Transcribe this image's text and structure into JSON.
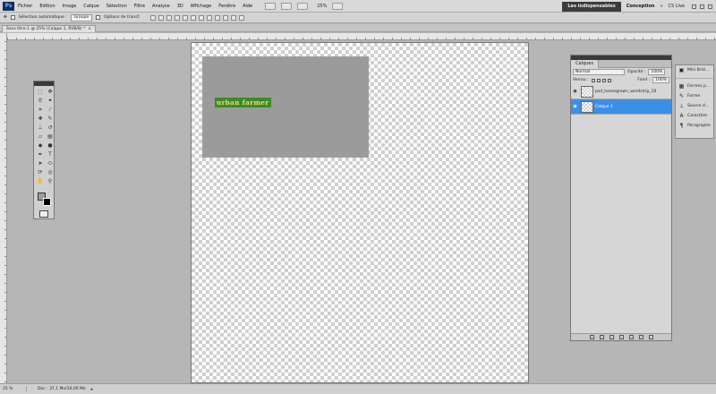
{
  "app": {
    "logo": "Ps"
  },
  "menubar": {
    "items": [
      "Fichier",
      "Edition",
      "Image",
      "Calque",
      "Sélection",
      "Filtre",
      "Analyse",
      "3D",
      "Affichage",
      "Fenêtre",
      "Aide"
    ],
    "zoom": "25%",
    "workspace_active": "Les indispensables",
    "workspace_other": "Conception",
    "cs_live": "CS Live"
  },
  "options": {
    "auto_select_label": "Sélection automatique :",
    "auto_select_value": "Groupe",
    "transform_label": "Options de transf."
  },
  "document": {
    "tab_title": "Sans titre-1 @ 25% (Calque 1, RVB/8) *",
    "brand_text": "urban farmer"
  },
  "layers": {
    "tab": "Calques",
    "blend_mode": "Normal",
    "opacity_label": "Opacité :",
    "opacity_value": "100%",
    "lock_label": "Verrou :",
    "fill_label": "Fond :",
    "fill_value": "100%",
    "items": [
      {
        "name": "psd_homegrown_wordstrip_10",
        "active": false
      },
      {
        "name": "Calque 1",
        "active": true
      }
    ]
  },
  "dock": {
    "items": [
      {
        "label": "Mini Brid...",
        "icon": "bridge-icon"
      },
      {
        "label": "Formes p...",
        "icon": "preset-shapes-icon"
      },
      {
        "label": "Forme",
        "icon": "brush-icon"
      },
      {
        "label": "Source d...",
        "icon": "clone-source-icon"
      },
      {
        "label": "Caractère",
        "icon": "character-icon"
      },
      {
        "label": "Paragraphe",
        "icon": "paragraph-icon"
      }
    ]
  },
  "status": {
    "zoom": "25 %",
    "doc": "Doc : 37,1 Mo/10,00 Mo"
  }
}
